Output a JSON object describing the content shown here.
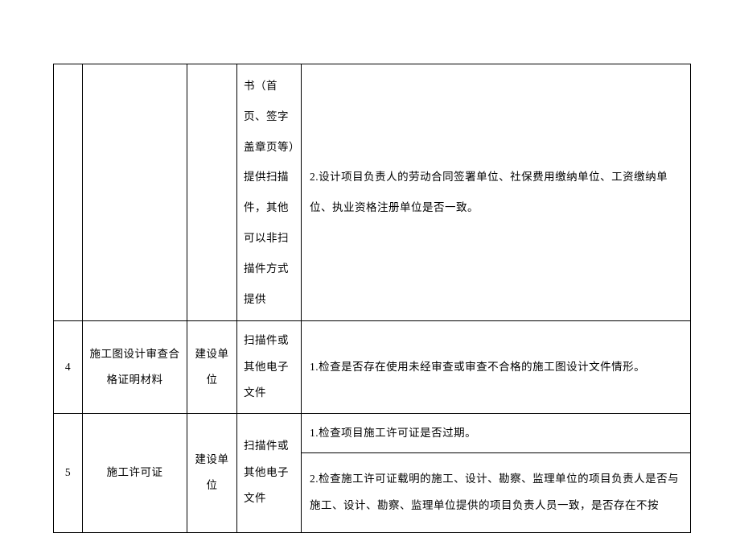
{
  "table": {
    "rows": [
      {
        "num": "",
        "material": "",
        "unit": "",
        "format": "书（首页、签字盖章页等）提供扫描件，其他可以非扫描件方式提供",
        "check": "2.设计项目负责人的劳动合同签署单位、社保费用缴纳单位、工资缴纳单位、执业资格注册单位是否一致。"
      },
      {
        "num": "4",
        "material": "施工图设计审查合格证明材料",
        "unit": "建设单位",
        "format": "扫描件或其他电子文件",
        "check": "1.检查是否存在使用未经审查或审查不合格的施工图设计文件情形。"
      },
      {
        "num": "5",
        "material": "施工许可证",
        "unit": "建设单位",
        "format": "扫描件或其他电子文件",
        "check_a": "1.检查项目施工许可证是否过期。",
        "check_b": "2.检查施工许可证载明的施工、设计、勘察、监理单位的项目负责人是否与施工、设计、勘察、监理单位提供的项目负责人员一致，是否存在不按"
      }
    ]
  }
}
